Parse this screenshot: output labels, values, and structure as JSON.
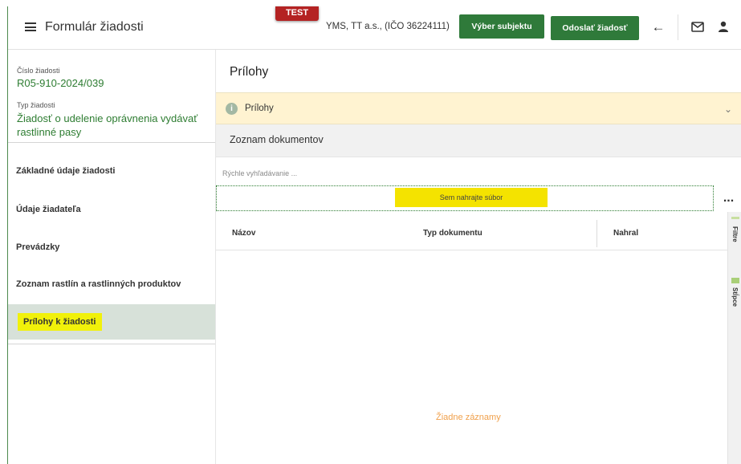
{
  "header": {
    "title": "Formulár žiadosti",
    "test_badge": "TEST",
    "subject": "YMS, TT a.s., (IČO 36224111)",
    "select_subject_label": "Výber subjektu",
    "send_request_label": "Odoslať žiadosť",
    "icons": [
      "menu-icon",
      "arrow-left-icon",
      "mail-icon",
      "user-icon"
    ]
  },
  "sidebar": {
    "request_number_label": "Číslo žiadosti",
    "request_number": "R05-910-2024/039",
    "request_type_label": "Typ žiadosti",
    "request_type_line1": "Žiadosť o udelenie oprávnenia vydávať",
    "request_type_line2": "rastlinné pasy",
    "items": [
      {
        "label": "Základné údaje žiadosti"
      },
      {
        "label": "Údaje žiadateľa"
      },
      {
        "label": "Prevádzky"
      },
      {
        "label": "Zoznam rastlín a rastlinných produktov"
      },
      {
        "label": "Prílohy k žiadosti",
        "active": true
      }
    ]
  },
  "main": {
    "title": "Prílohy",
    "info_label": "Prílohy",
    "documents_title": "Zoznam dokumentov",
    "search_placeholder": "Rýchle vyhľadávanie ...",
    "upload_label": "Sem nahrajte súbor",
    "more_label": "...",
    "columns": [
      "Názov",
      "Typ dokumentu",
      "Nahral"
    ],
    "empty_text": "Žiadne záznamy",
    "side_tabs": [
      "Filtre",
      "Stĺpce"
    ]
  },
  "colors": {
    "accent_green": "#2f7a3a",
    "test_red": "#b42323",
    "highlight_yellow": "#f4e300",
    "info_bg": "#fff3d1",
    "empty_orange": "#f0a04b"
  }
}
